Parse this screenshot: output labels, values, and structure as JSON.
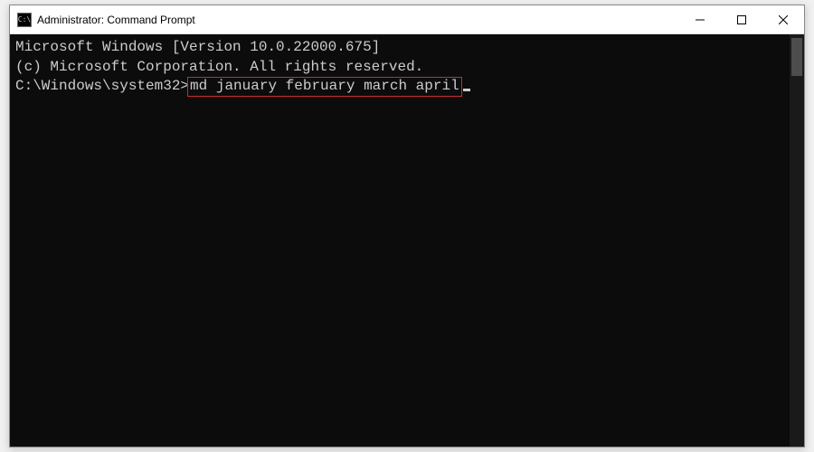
{
  "titlebar": {
    "icon_text": "C:\\",
    "title": "Administrator: Command Prompt"
  },
  "terminal": {
    "line1": "Microsoft Windows [Version 10.0.22000.675]",
    "line2": "(c) Microsoft Corporation. All rights reserved.",
    "blank": "",
    "prompt": "C:\\Windows\\system32>",
    "command": "md january february march april"
  },
  "annotation": {
    "highlight_color": "#cc2b2b"
  }
}
